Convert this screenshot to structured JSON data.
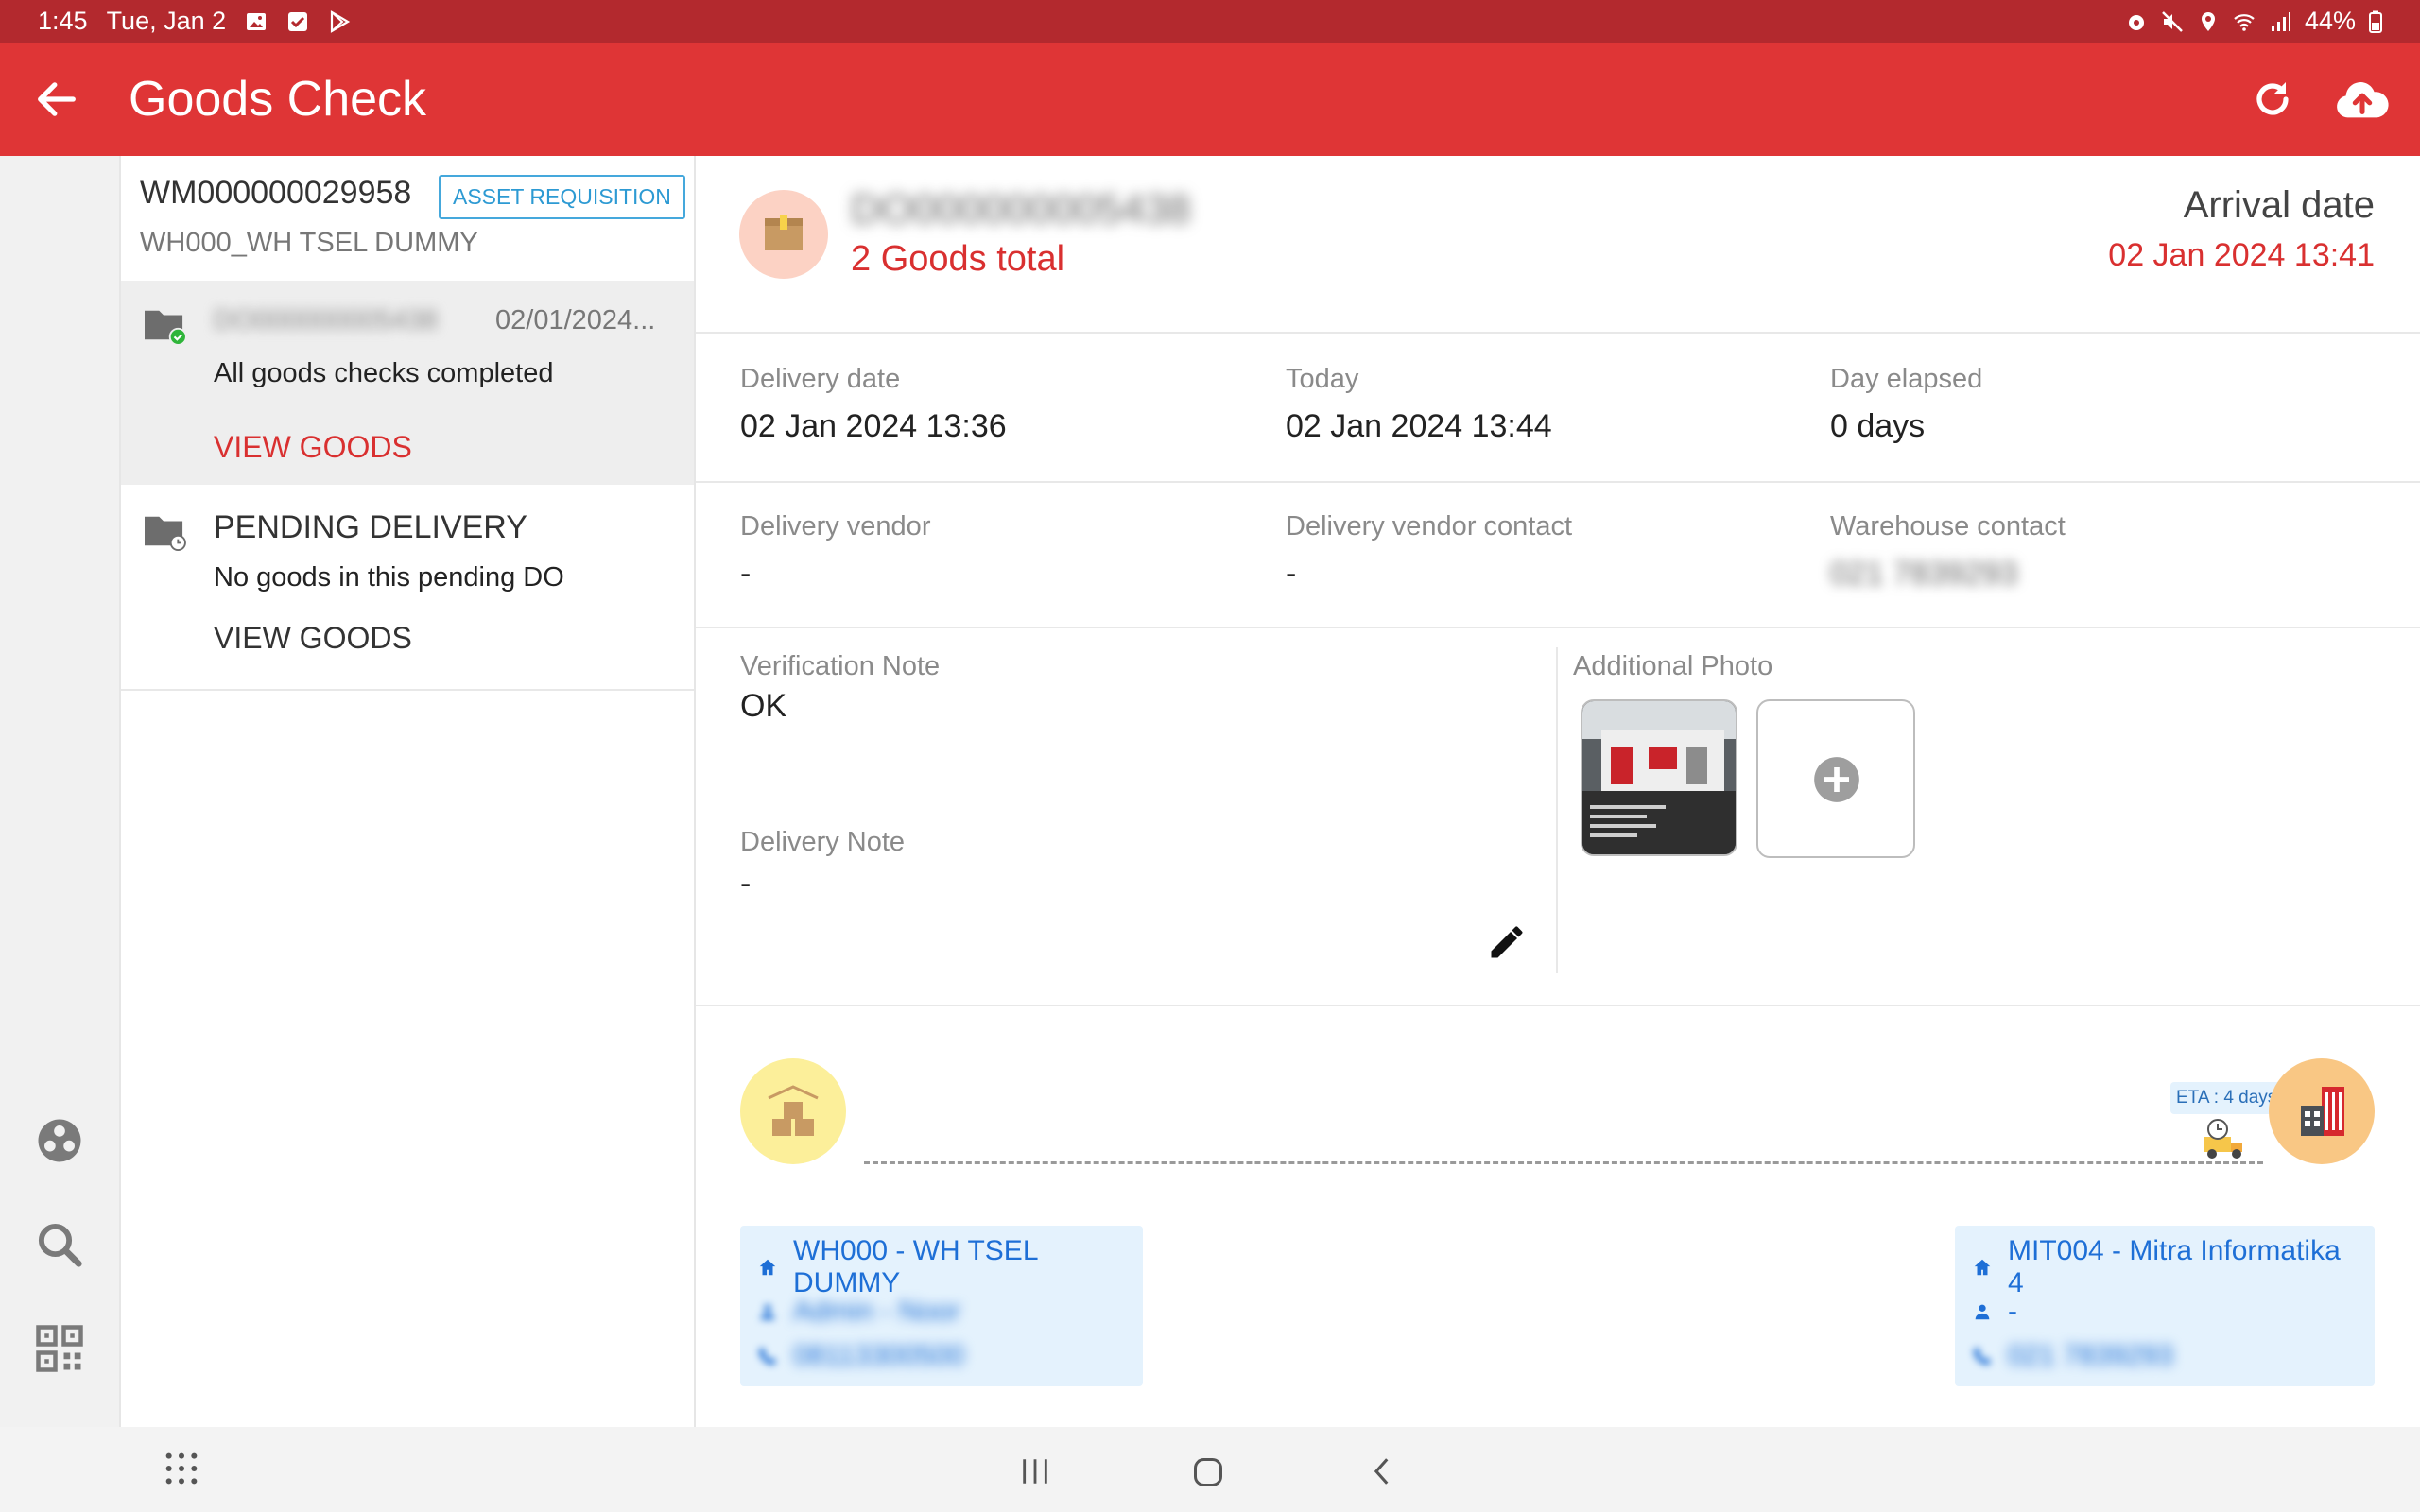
{
  "status_bar": {
    "time": "1:45",
    "date": "Tue, Jan 2",
    "battery": "44%"
  },
  "app_bar": {
    "title": "Goods Check"
  },
  "requisition": {
    "id": "WM000000029958",
    "badge": "ASSET REQUISITION",
    "warehouse": "WH000_WH TSEL DUMMY"
  },
  "do_list": {
    "items": [
      {
        "id_blurred": "DO000000005438",
        "date": "02/01/2024...",
        "description": "All goods checks completed",
        "action": "VIEW GOODS"
      },
      {
        "title": "PENDING DELIVERY",
        "description": "No goods in this pending DO",
        "action": "VIEW GOODS"
      }
    ]
  },
  "header": {
    "do_id_blurred": "DO000000005438",
    "goods_total": "2 Goods total",
    "arrival_label": "Arrival date",
    "arrival_value": "02 Jan 2024 13:41"
  },
  "details": {
    "delivery_date_label": "Delivery date",
    "delivery_date_value": "02 Jan 2024 13:36",
    "today_label": "Today",
    "today_value": "02 Jan 2024 13:44",
    "elapsed_label": "Day elapsed",
    "elapsed_value": "0 days",
    "vendor_label": "Delivery vendor",
    "vendor_value": "-",
    "vendor_contact_label": "Delivery vendor contact",
    "vendor_contact_value": "-",
    "warehouse_contact_label": "Warehouse contact",
    "warehouse_contact_value": "021 7839293"
  },
  "notes": {
    "verification_label": "Verification Note",
    "verification_value": "OK",
    "delivery_label": "Delivery Note",
    "delivery_value": "-",
    "photo_label": "Additional Photo"
  },
  "route": {
    "eta": "ETA : 4 days",
    "origin": {
      "name": "WH000 - WH TSEL DUMMY",
      "person": "Admin - Noor",
      "phone": "08113300500"
    },
    "destination": {
      "name": "MIT004 - Mitra Informatika 4",
      "person": "-",
      "phone": "021 7839293"
    }
  },
  "colors": {
    "primary": "#df3536",
    "status_bar": "#b3292e",
    "accent_red": "#d93030",
    "link_blue": "#1e6fd6",
    "card_bg": "#e4f2fd"
  }
}
